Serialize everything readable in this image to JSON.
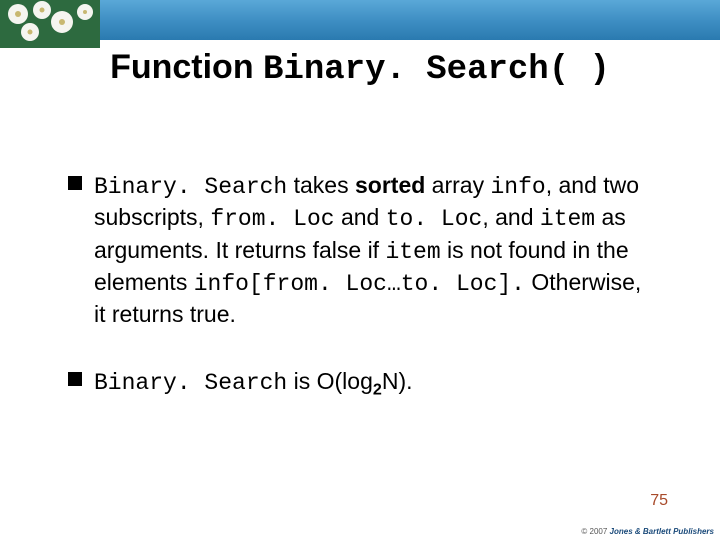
{
  "title": {
    "prefix": "Function ",
    "code": "Binary. Search( )"
  },
  "bullets": [
    {
      "segments": [
        {
          "t": "Binary. Search",
          "cls": "mono"
        },
        {
          "t": " takes ",
          "cls": "plain"
        },
        {
          "t": "sorted",
          "cls": ""
        },
        {
          "t": " array ",
          "cls": "plain"
        },
        {
          "t": "info",
          "cls": "mono"
        },
        {
          "t": ", and two subscripts, ",
          "cls": "plain"
        },
        {
          "t": "from. Loc",
          "cls": "mono"
        },
        {
          "t": " and ",
          "cls": "plain"
        },
        {
          "t": "to. Loc",
          "cls": "mono"
        },
        {
          "t": ", and ",
          "cls": "plain"
        },
        {
          "t": "item",
          "cls": "mono"
        },
        {
          "t": "  as arguments.  It returns false if ",
          "cls": "plain"
        },
        {
          "t": "item",
          "cls": "mono"
        },
        {
          "t": " is not found in the elements ",
          "cls": "plain"
        },
        {
          "t": "info[from. Loc…to. Loc].",
          "cls": "mono"
        },
        {
          "t": "   Otherwise, it returns true.",
          "cls": "plain"
        }
      ]
    },
    {
      "segments": [
        {
          "t": "Binary. Search",
          "cls": "mono"
        },
        {
          "t": " is O(log",
          "cls": "plain"
        },
        {
          "t": "2",
          "cls": "sub"
        },
        {
          "t": "N).",
          "cls": "plain"
        }
      ]
    }
  ],
  "page_number": "75",
  "copyright": {
    "symbol": "© 2007 ",
    "publisher": "Jones & Bartlett Publishers"
  }
}
